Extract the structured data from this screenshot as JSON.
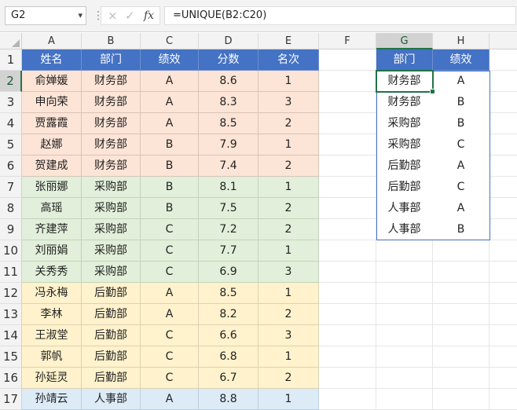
{
  "name_box": "G2",
  "formula": "=UNIQUE(B2:C20)",
  "icons": {
    "cancel": "×",
    "enter": "✓",
    "fx": "fx",
    "dropdown": "▾",
    "more": "⋮"
  },
  "columns": [
    "A",
    "B",
    "C",
    "D",
    "E",
    "F",
    "G",
    "H"
  ],
  "selected_column": "G",
  "selected_row": "2",
  "rows": [
    "1",
    "2",
    "3",
    "4",
    "5",
    "6",
    "7",
    "8",
    "9",
    "10",
    "11",
    "12",
    "13",
    "14",
    "15",
    "16",
    "17"
  ],
  "table": {
    "headers": [
      "姓名",
      "部门",
      "绩效",
      "分数",
      "名次"
    ],
    "data": [
      [
        "俞婵媛",
        "财务部",
        "A",
        "8.6",
        "1"
      ],
      [
        "申向荣",
        "财务部",
        "A",
        "8.3",
        "3"
      ],
      [
        "贾露霞",
        "财务部",
        "A",
        "8.5",
        "2"
      ],
      [
        "赵娜",
        "财务部",
        "B",
        "7.9",
        "1"
      ],
      [
        "贺建成",
        "财务部",
        "B",
        "7.4",
        "2"
      ],
      [
        "张丽娜",
        "采购部",
        "B",
        "8.1",
        "1"
      ],
      [
        "高瑶",
        "采购部",
        "B",
        "7.5",
        "2"
      ],
      [
        "齐建萍",
        "采购部",
        "C",
        "7.2",
        "2"
      ],
      [
        "刘丽娟",
        "采购部",
        "C",
        "7.7",
        "1"
      ],
      [
        "关秀秀",
        "采购部",
        "C",
        "6.9",
        "3"
      ],
      [
        "冯永梅",
        "后勤部",
        "A",
        "8.5",
        "1"
      ],
      [
        "李林",
        "后勤部",
        "A",
        "8.2",
        "2"
      ],
      [
        "王淑堂",
        "后勤部",
        "C",
        "6.6",
        "3"
      ],
      [
        "郭帆",
        "后勤部",
        "C",
        "6.8",
        "1"
      ],
      [
        "孙延灵",
        "后勤部",
        "C",
        "6.7",
        "2"
      ],
      [
        "孙靖云",
        "人事部",
        "A",
        "8.8",
        "1"
      ]
    ]
  },
  "result": {
    "headers": [
      "部门",
      "绩效"
    ],
    "data": [
      [
        "财务部",
        "A"
      ],
      [
        "财务部",
        "B"
      ],
      [
        "采购部",
        "B"
      ],
      [
        "采购部",
        "C"
      ],
      [
        "后勤部",
        "A"
      ],
      [
        "后勤部",
        "C"
      ],
      [
        "人事部",
        "A"
      ],
      [
        "人事部",
        "B"
      ]
    ]
  },
  "colors": {
    "header": "#4472c4",
    "finance": "#fce4d6",
    "purchase": "#e2efda",
    "logistics": "#fff2cc",
    "hr": "#ddebf7",
    "selection": "#217346"
  }
}
